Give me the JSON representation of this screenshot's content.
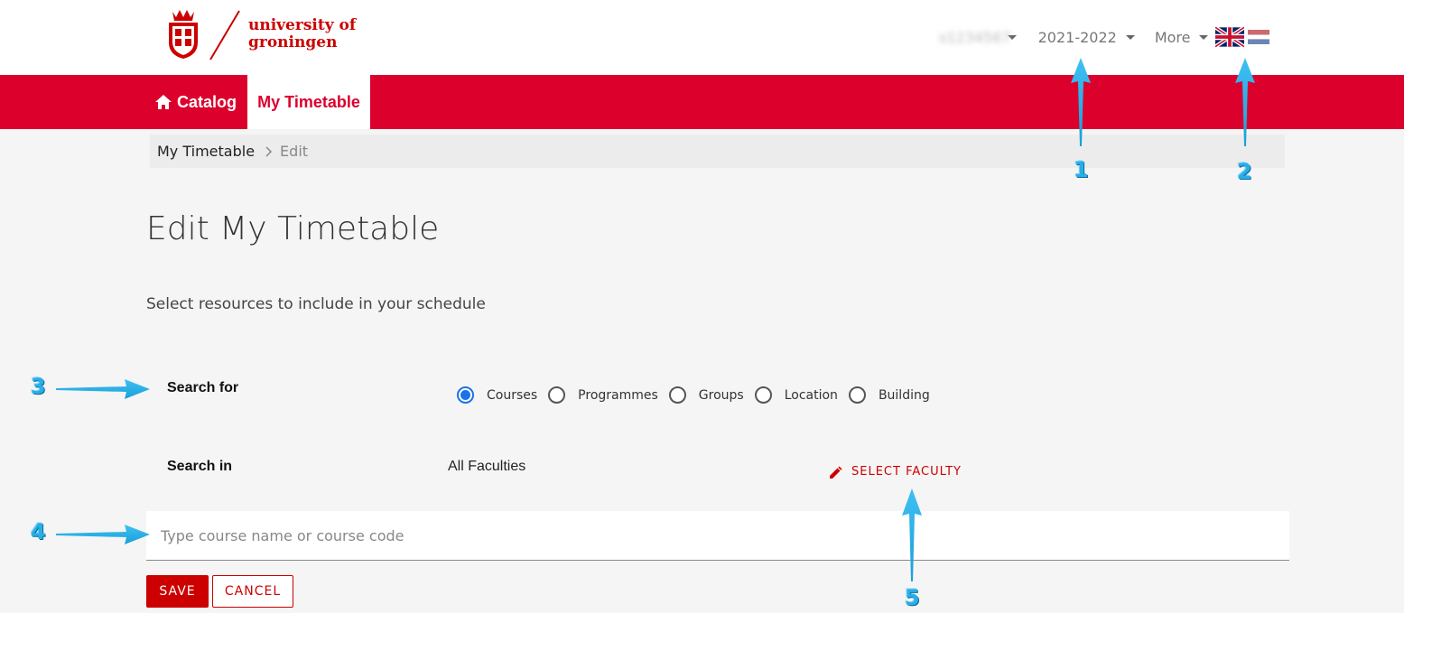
{
  "header": {
    "logo_line1": "university of",
    "logo_line2": "groningen",
    "user_name": "s1234567",
    "year_selector": "2021-2022",
    "more_label": "More",
    "lang_en_icon": "uk-flag-icon",
    "lang_nl_icon": "nl-flag-icon"
  },
  "nav": {
    "catalog_label": "Catalog",
    "my_timetable_label": "My Timetable"
  },
  "breadcrumb": {
    "items": [
      "My Timetable",
      "Edit"
    ]
  },
  "page": {
    "title": "Edit My Timetable",
    "subtitle": "Select resources to include in your schedule"
  },
  "form": {
    "search_for_label": "Search for",
    "search_in_label": "Search in",
    "search_options": [
      "Courses",
      "Programmes",
      "Groups",
      "Location",
      "Building"
    ],
    "selected_option": "Courses",
    "search_in_value": "All Faculties",
    "select_faculty_label": "SELECT FACULTY",
    "search_placeholder": "Type course name or course code",
    "save_label": "SAVE",
    "cancel_label": "CANCEL"
  },
  "callouts": [
    "1",
    "2",
    "3",
    "4",
    "5"
  ],
  "colors": {
    "brand_red": "#dc002d",
    "button_red": "#cc0000",
    "callout_blue": "#29aee8",
    "radio_blue": "#1a73e8"
  }
}
